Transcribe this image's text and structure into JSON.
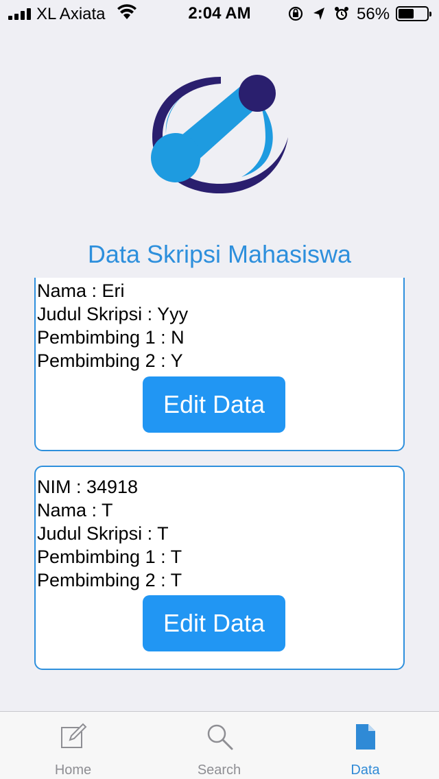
{
  "status_bar": {
    "carrier": "XL Axiata",
    "time": "2:04 AM",
    "battery_percent": "56%",
    "battery_level": 0.56
  },
  "header": {
    "title": "Data Skripsi Mahasiswa"
  },
  "cards": [
    {
      "lines": [
        "Nama : Eri",
        "Judul Skripsi : Yyy",
        "Pembimbing 1 : N",
        "Pembimbing 2 : Y"
      ],
      "button_label": "Edit Data"
    },
    {
      "lines": [
        "NIM : 34918",
        "Nama : T",
        "Judul Skripsi : T",
        "Pembimbing 1 : T",
        "Pembimbing 2 : T"
      ],
      "button_label": "Edit Data"
    }
  ],
  "tab_bar": {
    "tabs": [
      {
        "label": "Home",
        "icon": "compose-icon",
        "active": false
      },
      {
        "label": "Search",
        "icon": "search-icon",
        "active": false
      },
      {
        "label": "Data",
        "icon": "document-icon",
        "active": true
      }
    ]
  },
  "colors": {
    "accent": "#2d8fdc",
    "button": "#2196f3",
    "logo_dark": "#2a1f6e",
    "logo_light": "#1e9be0"
  }
}
